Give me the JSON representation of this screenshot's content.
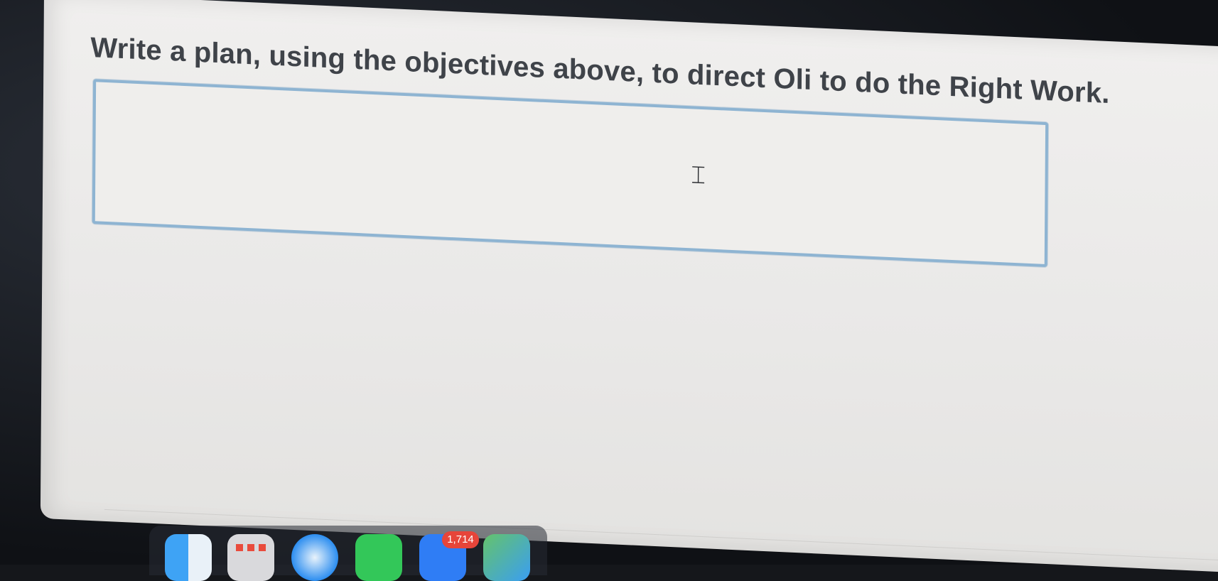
{
  "question": {
    "prompt": "Write a plan, using the objectives above, to direct Oli to do the Right Work."
  },
  "answer_field": {
    "value": "",
    "cursor_glyph": "⌶"
  },
  "dock": {
    "apps": [
      {
        "name": "finder-icon"
      },
      {
        "name": "launchpad-icon"
      },
      {
        "name": "safari-icon"
      },
      {
        "name": "messages-icon"
      },
      {
        "name": "mail-icon"
      },
      {
        "name": "maps-icon"
      }
    ],
    "mail_badge": "1,714"
  },
  "colors": {
    "field_border": "#8eb4d2",
    "prompt_text": "#3f4349",
    "badge": "#e6453a"
  }
}
